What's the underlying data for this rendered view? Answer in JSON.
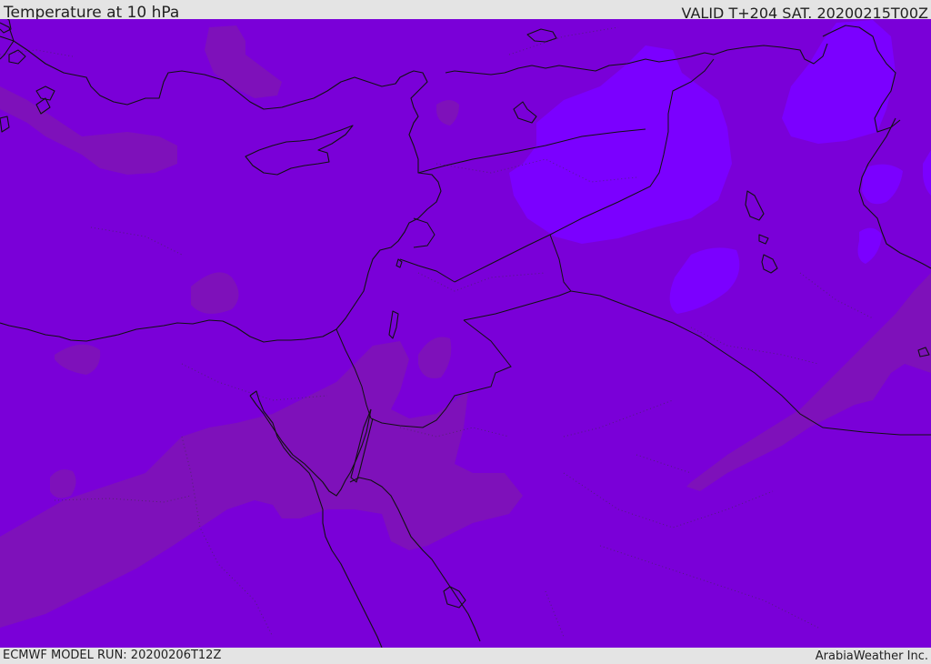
{
  "header": {
    "title": "Temperature at 10 hPa",
    "valid": "VALID T+204 SAT. 20200215T00Z"
  },
  "footer": {
    "model_run": "ECMWF MODEL RUN: 20200206T12Z",
    "credit": "ArabiaWeather Inc."
  },
  "colors": {
    "background_field": "#7a00d8",
    "warmer_bands": "#7e12b8",
    "colder_core": "#7b00ff",
    "coastline": "#111111"
  },
  "map": {
    "region": "Eastern Mediterranean / Middle East",
    "field": "10 hPa temperature shaded",
    "features": [
      "coastlines",
      "country-borders",
      "internal-borders-dotted"
    ]
  }
}
